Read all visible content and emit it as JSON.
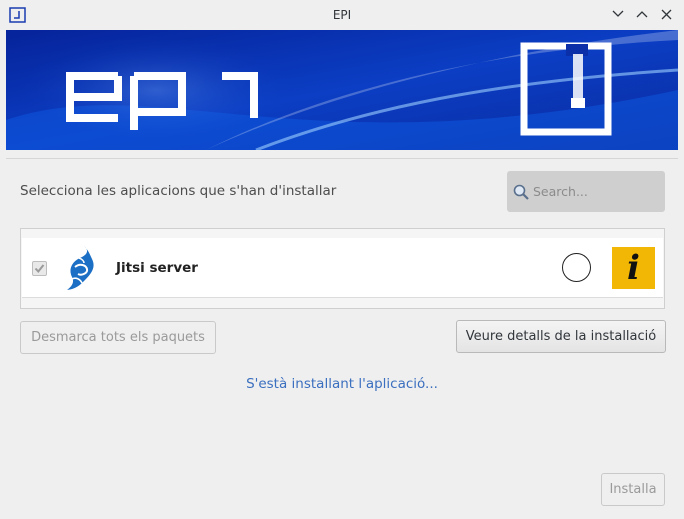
{
  "window": {
    "title": "EPI",
    "controls": [
      "minimize-icon",
      "maximize-icon",
      "close-icon"
    ]
  },
  "banner": {
    "logo_text": "epi",
    "colors": {
      "primary": "#0a2fa8",
      "accent": "#ffffff"
    }
  },
  "main": {
    "instruction": "Selecciona les aplicacions que s'han d'installar",
    "search": {
      "placeholder": "Search..."
    },
    "apps": [
      {
        "name": "Jitsi server",
        "checked": true,
        "checkbox_enabled": false,
        "icon": "jitsi-logo-icon",
        "info_icon": "i"
      }
    ],
    "buttons": {
      "unmark_all": "Desmarca tots els paquets",
      "view_details": "Veure detalls de la installació",
      "install": "Installa"
    },
    "status_message": "S'està installant l'aplicació..."
  },
  "colors": {
    "info": "#f2b705",
    "status_text": "#3b6fbf",
    "disabled_text": "#9a9a9a"
  }
}
